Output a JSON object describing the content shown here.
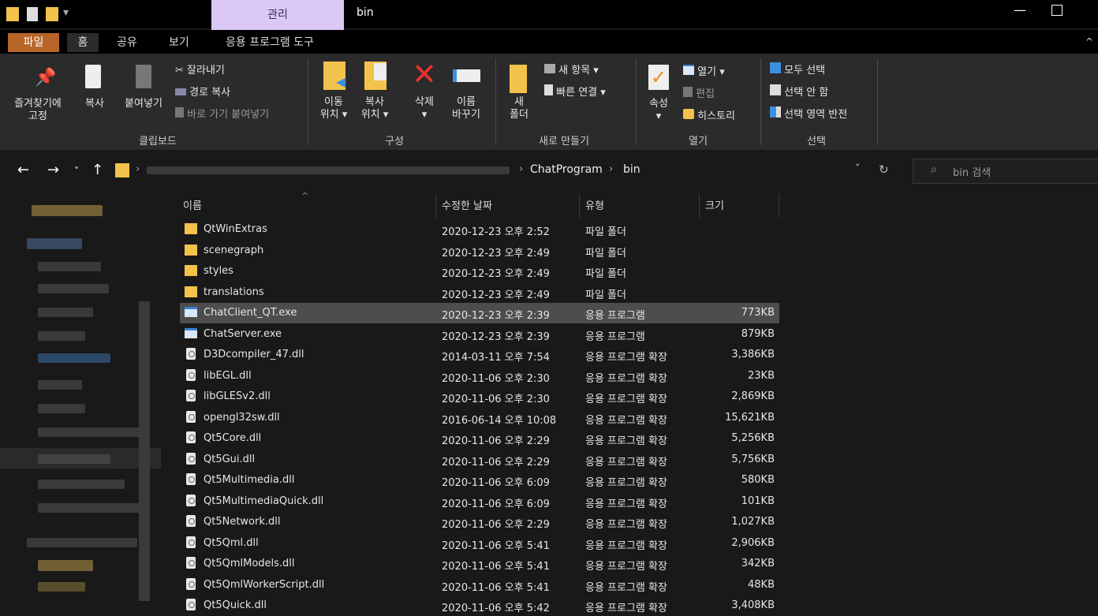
{
  "window": {
    "title": "bin",
    "context_tab": "관리",
    "minimize": "—"
  },
  "tabs": [
    "파일",
    "홈",
    "공유",
    "보기",
    "응용 프로그램 도구"
  ],
  "ribbon": {
    "clipboard": {
      "pin_line1": "즐겨찾기에",
      "pin_line2": "고정",
      "copy": "복사",
      "paste": "붙여넣기",
      "cut": "잘라내기",
      "copy_path": "경로 복사",
      "paste_shortcut": "바로 가기 붙여넣기",
      "label": "클립보드"
    },
    "organize": {
      "move_line1": "이동",
      "move_line2": "위치 ▾",
      "copyto_line1": "복사",
      "copyto_line2": "위치 ▾",
      "delete": "삭제",
      "delete_arrow": "▾",
      "rename_line1": "이름",
      "rename_line2": "바꾸기",
      "label": "구성"
    },
    "new": {
      "folder_line1": "새",
      "folder_line2": "폴더",
      "new_item": "새 항목 ▾",
      "easy_access": "빠른 연결 ▾",
      "label": "새로 만들기"
    },
    "open": {
      "properties": "속성",
      "properties_arrow": "▾",
      "open": "열기 ▾",
      "edit": "편집",
      "history": "히스토리",
      "label": "열기"
    },
    "select": {
      "select_all": "모두 선택",
      "select_none": "선택 안 함",
      "invert": "선택 영역 반전",
      "label": "선택"
    }
  },
  "address": {
    "crumbs": [
      "ChatProgram",
      "bin"
    ],
    "sep": "›",
    "search_placeholder": "bin 검색"
  },
  "columns": {
    "name": "이름",
    "date": "수정한 날짜",
    "type": "유형",
    "size": "크기"
  },
  "files": [
    {
      "name": "QtWinExtras",
      "date": "2020-12-23 오후 2:52",
      "type": "파일 폴더",
      "size": "",
      "kind": "folder"
    },
    {
      "name": "scenegraph",
      "date": "2020-12-23 오후 2:49",
      "type": "파일 폴더",
      "size": "",
      "kind": "folder"
    },
    {
      "name": "styles",
      "date": "2020-12-23 오후 2:49",
      "type": "파일 폴더",
      "size": "",
      "kind": "folder"
    },
    {
      "name": "translations",
      "date": "2020-12-23 오후 2:49",
      "type": "파일 폴더",
      "size": "",
      "kind": "folder"
    },
    {
      "name": "ChatClient_QT.exe",
      "date": "2020-12-23 오후 2:39",
      "type": "응용 프로그램",
      "size": "773KB",
      "kind": "exe",
      "selected": true
    },
    {
      "name": "ChatServer.exe",
      "date": "2020-12-23 오후 2:39",
      "type": "응용 프로그램",
      "size": "879KB",
      "kind": "exe"
    },
    {
      "name": "D3Dcompiler_47.dll",
      "date": "2014-03-11 오후 7:54",
      "type": "응용 프로그램 확장",
      "size": "3,386KB",
      "kind": "dll"
    },
    {
      "name": "libEGL.dll",
      "date": "2020-11-06 오후 2:30",
      "type": "응용 프로그램 확장",
      "size": "23KB",
      "kind": "dll"
    },
    {
      "name": "libGLESv2.dll",
      "date": "2020-11-06 오후 2:30",
      "type": "응용 프로그램 확장",
      "size": "2,869KB",
      "kind": "dll"
    },
    {
      "name": "opengl32sw.dll",
      "date": "2016-06-14 오후 10:08",
      "type": "응용 프로그램 확장",
      "size": "15,621KB",
      "kind": "dll"
    },
    {
      "name": "Qt5Core.dll",
      "date": "2020-11-06 오후 2:29",
      "type": "응용 프로그램 확장",
      "size": "5,256KB",
      "kind": "dll"
    },
    {
      "name": "Qt5Gui.dll",
      "date": "2020-11-06 오후 2:29",
      "type": "응용 프로그램 확장",
      "size": "5,756KB",
      "kind": "dll"
    },
    {
      "name": "Qt5Multimedia.dll",
      "date": "2020-11-06 오후 6:09",
      "type": "응용 프로그램 확장",
      "size": "580KB",
      "kind": "dll"
    },
    {
      "name": "Qt5MultimediaQuick.dll",
      "date": "2020-11-06 오후 6:09",
      "type": "응용 프로그램 확장",
      "size": "101KB",
      "kind": "dll"
    },
    {
      "name": "Qt5Network.dll",
      "date": "2020-11-06 오후 2:29",
      "type": "응용 프로그램 확장",
      "size": "1,027KB",
      "kind": "dll"
    },
    {
      "name": "Qt5Qml.dll",
      "date": "2020-11-06 오후 5:41",
      "type": "응용 프로그램 확장",
      "size": "2,906KB",
      "kind": "dll"
    },
    {
      "name": "Qt5QmlModels.dll",
      "date": "2020-11-06 오후 5:41",
      "type": "응용 프로그램 확장",
      "size": "342KB",
      "kind": "dll"
    },
    {
      "name": "Qt5QmlWorkerScript.dll",
      "date": "2020-11-06 오후 5:41",
      "type": "응용 프로그램 확장",
      "size": "48KB",
      "kind": "dll"
    },
    {
      "name": "Qt5Quick.dll",
      "date": "2020-11-06 오후 5:42",
      "type": "응용 프로그램 확장",
      "size": "3,408KB",
      "kind": "dll"
    }
  ],
  "colors": {
    "file_tab": "#b8652a",
    "context_tab": "#d9c9f4",
    "selected_row": "#4d4d4d",
    "folder": "#f2c24b"
  }
}
